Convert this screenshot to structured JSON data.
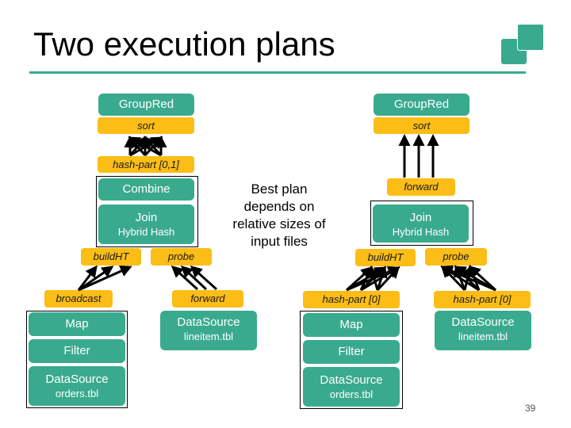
{
  "slide": {
    "title": "Two execution plans",
    "page_number": "39",
    "note": "Best plan depends on relative sizes of input files",
    "accent_color": "#3aaa8e",
    "channel_color": "#fbbd16"
  },
  "plan_left": {
    "group_red": "GroupRed",
    "sort": "sort",
    "hash_part": "hash-part [0,1]",
    "combine": "Combine",
    "join": "Join",
    "join_sub": "Hybrid Hash",
    "build_ht": "buildHT",
    "probe": "probe",
    "broadcast": "broadcast",
    "forward": "forward",
    "map": "Map",
    "filter": "Filter",
    "datasource_orders": "DataSource",
    "datasource_orders_sub": "orders.tbl",
    "datasource_lineitem": "DataSource",
    "datasource_lineitem_sub": "lineitem.tbl"
  },
  "plan_right": {
    "group_red": "GroupRed",
    "sort": "sort",
    "forward": "forward",
    "join": "Join",
    "join_sub": "Hybrid Hash",
    "build_ht": "buildHT",
    "probe": "probe",
    "hash_part_build": "hash-part [0]",
    "hash_part_probe": "hash-part [0]",
    "map": "Map",
    "filter": "Filter",
    "datasource_orders": "DataSource",
    "datasource_orders_sub": "orders.tbl",
    "datasource_lineitem": "DataSource",
    "datasource_lineitem_sub": "lineitem.tbl"
  }
}
